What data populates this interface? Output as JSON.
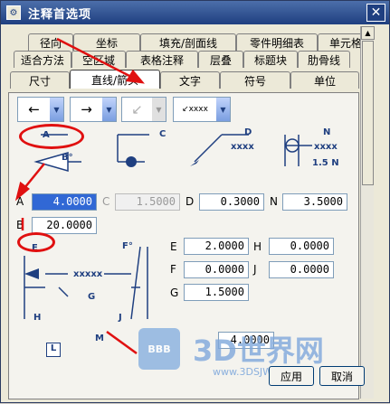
{
  "window": {
    "title": "注释首选项",
    "close_glyph": "✕",
    "app_icon": "⚙"
  },
  "tabs": {
    "row1": [
      "径向",
      "坐标",
      "填充/剖面线",
      "零件明细表",
      "单元格"
    ],
    "row2": [
      "适合方法",
      "空区域",
      "表格注释",
      "层叠",
      "标题块",
      "肋骨线"
    ],
    "row3": [
      "尺寸",
      "直线/箭头",
      "文字",
      "符号",
      "单位"
    ],
    "active": "直线/箭头"
  },
  "arrow_selectors": [
    {
      "glyph": "←",
      "enabled": true
    },
    {
      "glyph": "→",
      "enabled": true
    },
    {
      "glyph": "↙",
      "enabled": false
    },
    {
      "glyph": "↙xxxx",
      "enabled": true
    }
  ],
  "diagram_labels": {
    "A": "A",
    "B": "B°",
    "C": "C",
    "D": "D",
    "N": "N",
    "xxxx": "xxxx",
    "n15": "1.5 N",
    "E": "E",
    "F": "F°",
    "G": "G",
    "H": "H",
    "J": "J",
    "xxxxx": "xxxxx",
    "M": "M",
    "L": "L"
  },
  "fields": {
    "A": {
      "label": "A",
      "value": "4.0000"
    },
    "C": {
      "label": "C",
      "value": "1.5000"
    },
    "D": {
      "label": "D",
      "value": "0.3000"
    },
    "N": {
      "label": "N",
      "value": "3.5000"
    },
    "B": {
      "label": "B",
      "value": "20.0000"
    },
    "E": {
      "label": "E",
      "value": "2.0000"
    },
    "H": {
      "label": "H",
      "value": "0.0000"
    },
    "F": {
      "label": "F",
      "value": "0.0000"
    },
    "J": {
      "label": "J",
      "value": "0.0000"
    },
    "G": {
      "label": "G",
      "value": "1.5000"
    },
    "L": {
      "label": "L",
      "value": "4.0000"
    }
  },
  "buttons": {
    "apply": "应用",
    "cancel": "取消"
  },
  "watermark": {
    "logo": "BBB",
    "brand": "3D世界网",
    "url": "www.3DSJW.com"
  },
  "colors": {
    "accent": "#1f3f80",
    "annotation": "#e01010",
    "selection": "#3168d5"
  }
}
